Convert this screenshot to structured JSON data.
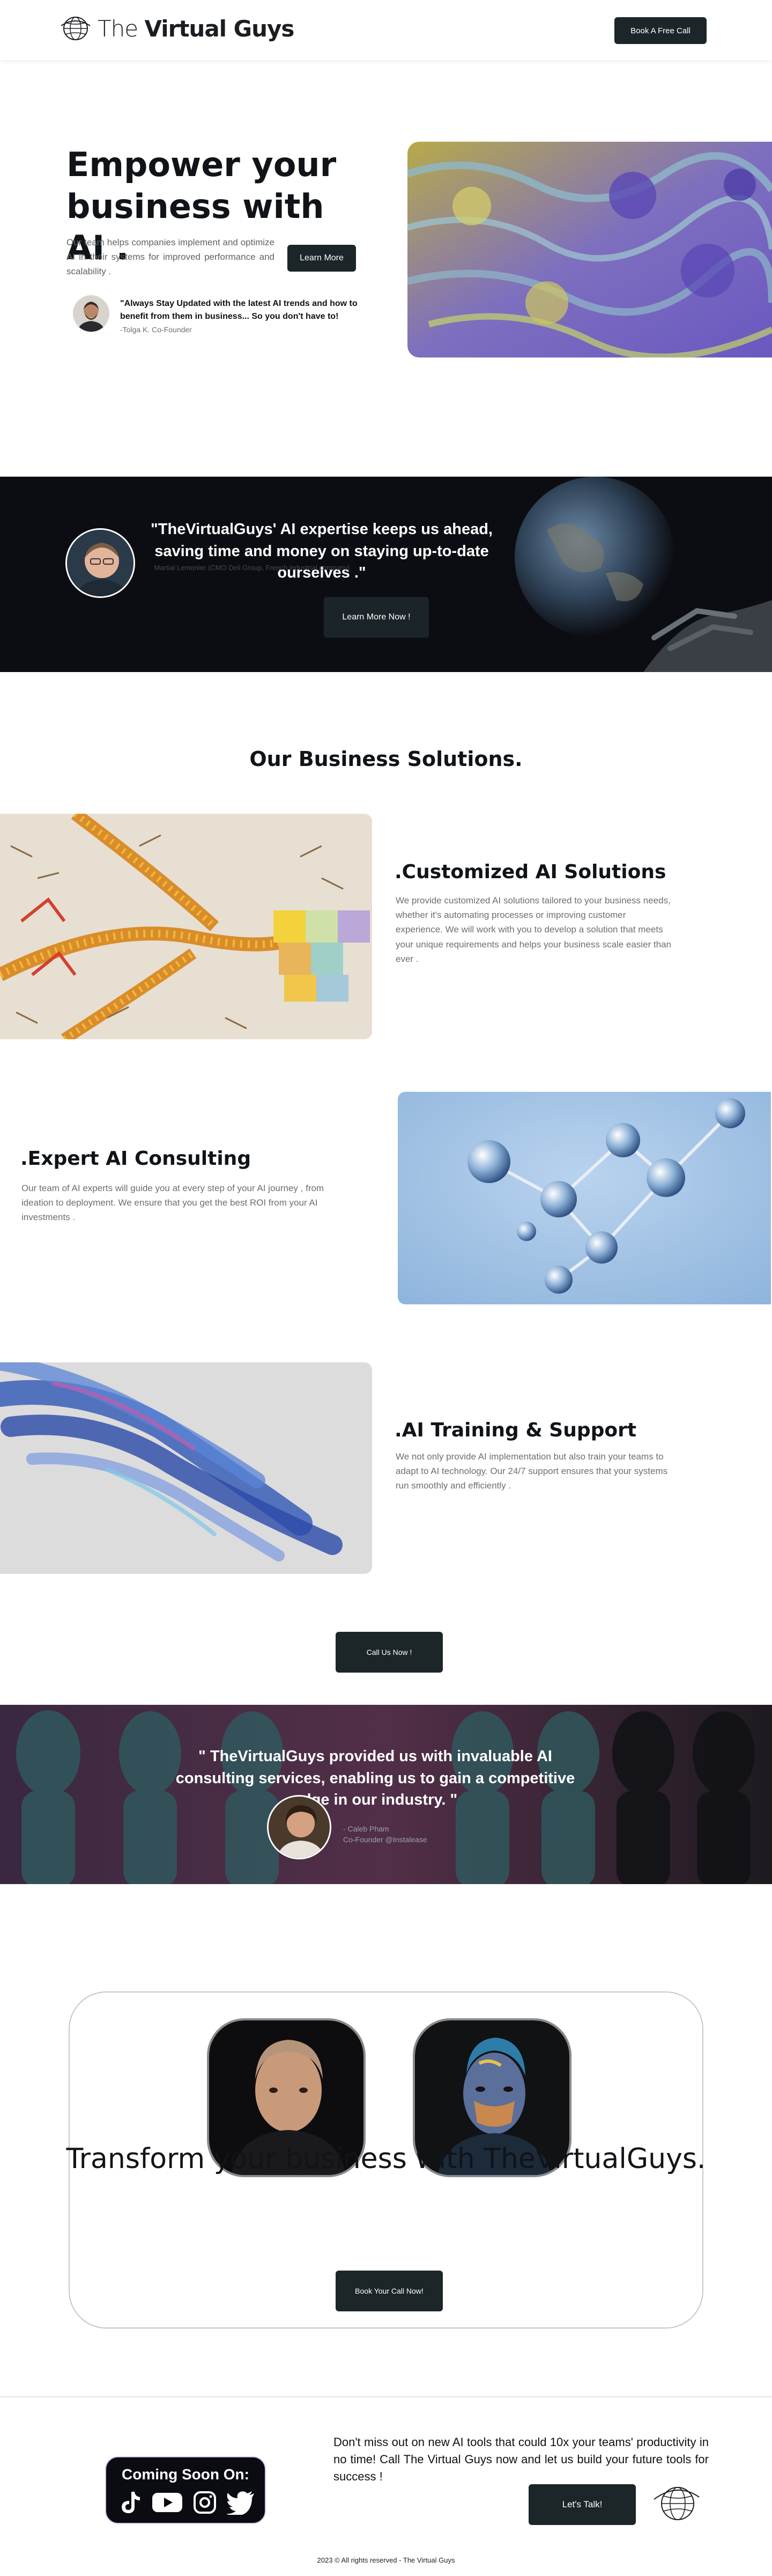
{
  "header": {
    "brand_light": "The ",
    "brand_bold": "Virtual Guys",
    "cta_label": "Book A Free Call"
  },
  "hero": {
    "title": "Empower your business with AI .",
    "description": "Our team helps companies implement and optimize AI in their systems for improved performance and scalability .",
    "button_label": "Learn More",
    "quote": "\"Always Stay Updated with the latest AI trends and how to benefit from them in business... So you don't have to!",
    "quote_author": "-Tolga K. Co-Founder"
  },
  "testimonial_1": {
    "quote": "\"TheVirtualGuys' AI expertise keeps us ahead, saving time and money on staying up-to-date ourselves .\"",
    "author": "Martial Lemonier (CMO Deli Group, French industrial company)",
    "button_label": "Learn More Now !"
  },
  "solutions": {
    "title": "Our Business Solutions.",
    "items": [
      {
        "title": ".Customized AI Solutions",
        "description": "We provide customized AI solutions tailored to your business needs, whether it's automating processes or improving customer experience. We will work with you to develop a solution that meets your unique requirements and helps your business scale easier than ever ."
      },
      {
        "title": ".Expert AI Consulting",
        "description": "Our team of AI experts will guide you at every step of your AI journey , from ideation to deployment. We ensure that you get the best ROI from your AI investments ."
      },
      {
        "title": ".AI Training & Support",
        "description": "We not only provide AI implementation but also train your teams to adapt to AI technology. Our 24/7 support ensures that your systems run smoothly and efficiently ."
      }
    ],
    "button_label": "Call Us Now !"
  },
  "testimonial_2": {
    "quote": "\" TheVirtualGuys provided us with invaluable AI consulting services, enabling us to gain a competitive edge in our industry. \"",
    "author_name": "- Caleb Pham",
    "author_role": "Co-Founder @Instalease"
  },
  "cta": {
    "title": "Transform your business with TheVirtualGuys.",
    "button_label": "Book Your Call Now!"
  },
  "footer": {
    "text": "Don't miss out on new AI tools that could 10x your teams' productivity in no time! Call The Virtual Guys now and let us build your future tools for success !",
    "button_label": "Let's Talk!",
    "coming_soon": "Coming Soon On:",
    "social_icons": [
      "tiktok-icon",
      "youtube-icon",
      "instagram-icon",
      "twitter-icon"
    ],
    "copyright": "2023 © All rights reserved - The Virtual Guys"
  },
  "colors": {
    "primary_button": "#1c2629",
    "dark_band": "#0c0d12",
    "text_dark": "#101418",
    "text_muted": "#6b6f73"
  }
}
